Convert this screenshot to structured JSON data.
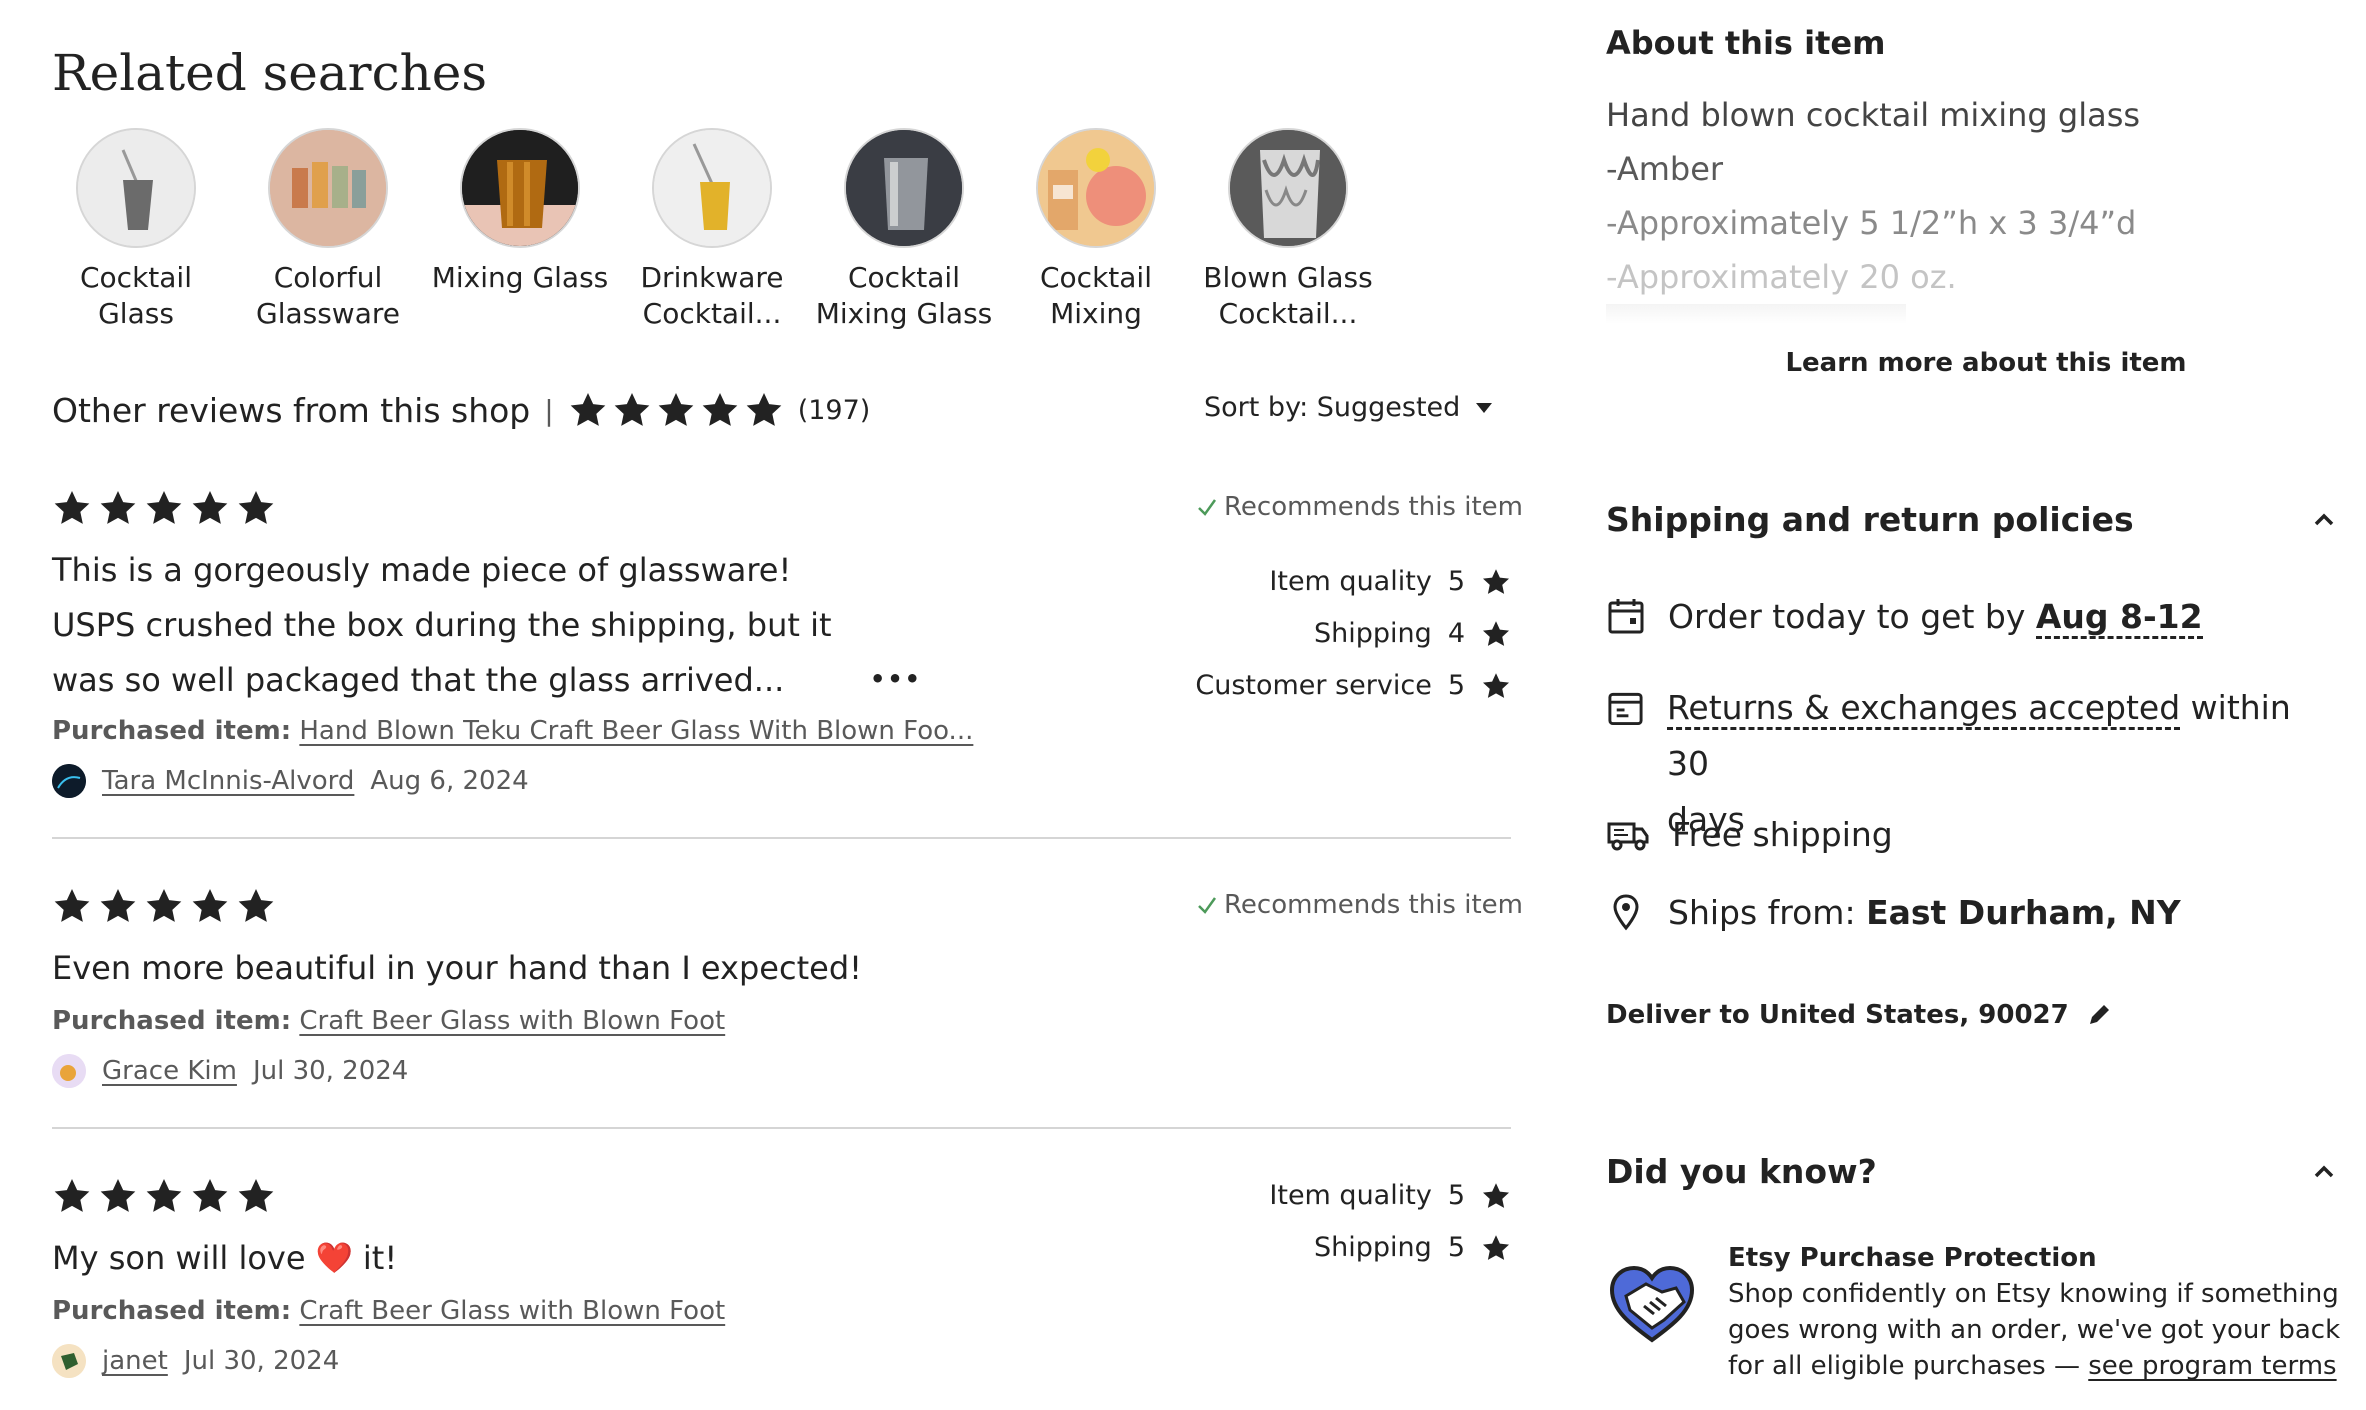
{
  "related": {
    "title": "Related searches",
    "items": [
      {
        "label_1": "Cocktail",
        "label_2": "Glass"
      },
      {
        "label_1": "Colorful",
        "label_2": "Glassware"
      },
      {
        "label_1": "Mixing Glass",
        "label_2": ""
      },
      {
        "label_1": "Drinkware",
        "label_2": "Cocktail..."
      },
      {
        "label_1": "Cocktail",
        "label_2": "Mixing Glass"
      },
      {
        "label_1": "Cocktail",
        "label_2": "Mixing"
      },
      {
        "label_1": "Blown Glass",
        "label_2": "Cocktail..."
      }
    ]
  },
  "reviews_header": {
    "title": "Other reviews from this shop",
    "separator": "|",
    "count": "(197)",
    "sort_label": "Sort by: Suggested"
  },
  "reviews": [
    {
      "recommends": "Recommends this item",
      "text_1": "This is a gorgeously made piece of glassware!",
      "text_2": "USPS crushed the box during the shipping, but it",
      "text_3": "was so well packaged that the glass arrived...",
      "more": "•••",
      "purchased_label": "Purchased item:",
      "purchased_item": "Hand Blown Teku Craft Beer Glass With Blown Foo...",
      "reviewer": "Tara McInnis-Alvord",
      "date": "Aug 6, 2024",
      "ratings": [
        {
          "label": "Item quality",
          "value": "5"
        },
        {
          "label": "Shipping",
          "value": "4"
        },
        {
          "label": "Customer service",
          "value": "5"
        }
      ]
    },
    {
      "recommends": "Recommends this item",
      "text_1": "Even more beautiful in your hand than I expected!",
      "purchased_label": "Purchased item:",
      "purchased_item": "Craft Beer Glass with Blown Foot",
      "reviewer": "Grace Kim",
      "date": "Jul 30, 2024"
    },
    {
      "text_before": "My son will love",
      "emoji": "❤️",
      "text_after": "it!",
      "purchased_label": "Purchased item:",
      "purchased_item": "Craft Beer Glass with Blown Foot",
      "reviewer": "janet",
      "date": "Jul 30, 2024",
      "ratings": [
        {
          "label": "Item quality",
          "value": "5"
        },
        {
          "label": "Shipping",
          "value": "5"
        }
      ]
    }
  ],
  "about": {
    "title": "About this item",
    "lines": [
      "Hand blown cocktail mixing glass",
      "-Amber",
      "-Approximately 5 1/2”h x 3 3/4”d",
      "-Approximately 20 oz."
    ],
    "learn_more": "Learn more about this item"
  },
  "shipping": {
    "title": "Shipping and return policies",
    "order_prefix": "Order today to get by",
    "order_dates": "Aug 8-12",
    "returns_link": "Returns & exchanges accepted",
    "returns_suffix": "within 30",
    "returns_line2": "days",
    "free_shipping": "Free shipping",
    "ships_from_label": "Ships from:",
    "ships_from_value": "East Durham, NY",
    "deliver_to": "Deliver to United States, 90027"
  },
  "did_you_know": {
    "title": "Did you know?",
    "heading": "Etsy Purchase Protection",
    "line_1": "Shop confidently on Etsy knowing if something",
    "line_2": "goes wrong with an order, we've got your back",
    "line_3_prefix": "for all eligible purchases —",
    "terms_link": "see program terms"
  },
  "colors": {
    "text": "#222222",
    "muted": "#595959",
    "check": "#4d9a5a",
    "divider": "#d5d5d5"
  }
}
